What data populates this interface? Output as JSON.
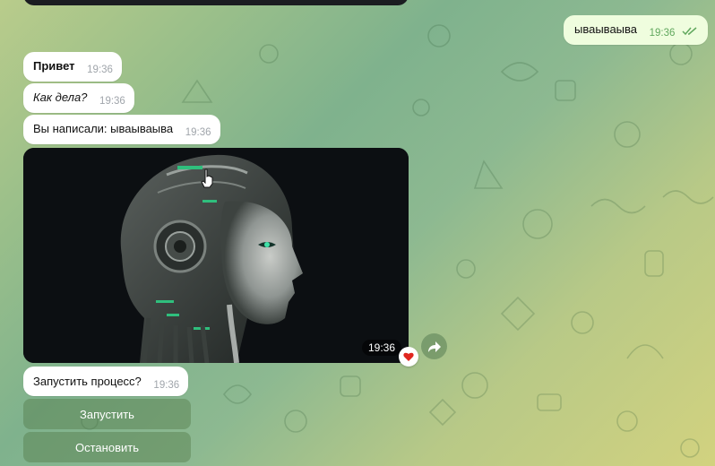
{
  "messages": [
    {
      "id": "out1",
      "text": "ываываыва",
      "time": "19:36",
      "status": "read"
    },
    {
      "id": "in1",
      "text": "Привет",
      "time": "19:36"
    },
    {
      "id": "in2",
      "text": "Как дела?",
      "time": "19:36"
    },
    {
      "id": "in3",
      "text": "Вы написали: ываываыва",
      "time": "19:36"
    },
    {
      "id": "photo",
      "time": "19:36",
      "reaction": "heart"
    },
    {
      "id": "in4",
      "text": "Запустить процесс?",
      "time": "19:36"
    }
  ],
  "inline_keyboard": {
    "start_label": "Запустить",
    "stop_label": "Остановить"
  },
  "icons": {
    "read_checks": "double-check-icon",
    "share": "share-arrow-icon",
    "reaction": "heart-icon"
  },
  "colors": {
    "incoming_bubble": "#ffffff",
    "outgoing_bubble": "#effdde",
    "outgoing_time": "#61a85e"
  }
}
